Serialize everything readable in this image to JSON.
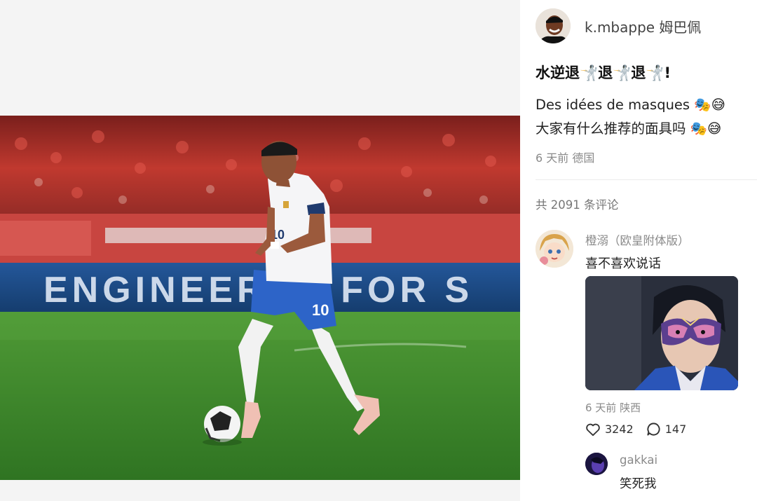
{
  "post": {
    "author": "k.mbappe 姆巴佩",
    "title": "水逆退🤺退🤺退🤺!",
    "body_line_1": "Des idées de masques 🎭😅",
    "body_line_2": "大家有什么推荐的面具吗 🎭😅",
    "meta": "6 天前 德国"
  },
  "photo": {
    "banner_text": "ENGINEERED FOR S",
    "shirt_number": "10",
    "shorts_number": "10"
  },
  "comments": {
    "total": "共 2091 条评论",
    "items": [
      {
        "user": "橙溺（欧皇附体版）",
        "text": "喜不喜欢说话",
        "meta": "6 天前 陕西",
        "likes": "3242",
        "replies": "147"
      }
    ],
    "reply": {
      "user": "gakkai",
      "text": "笑死我"
    }
  },
  "icons": {
    "like": "heart-outline-icon",
    "reply": "speech-bubble-icon"
  },
  "colors": {
    "pitch": "#3f8a2e",
    "stands": "#b8322e",
    "banner": "#1c4e86",
    "meta_gray": "#8a8a8a"
  }
}
